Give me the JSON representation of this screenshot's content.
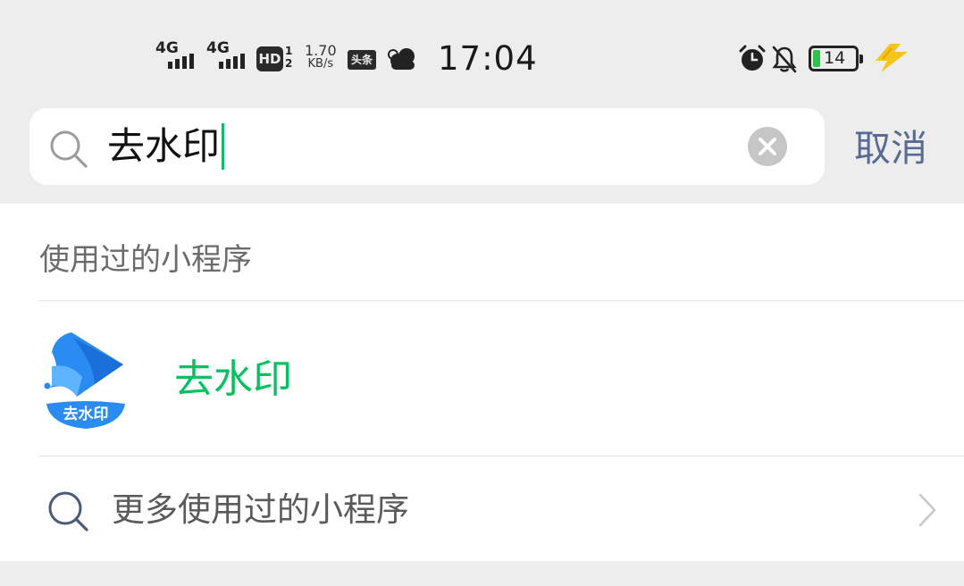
{
  "status_bar": {
    "network_1": "4G",
    "network_2": "4G",
    "hd_label": "HD",
    "hd_sub_1": "1",
    "hd_sub_2": "2",
    "speed_value": "1.70",
    "speed_unit": "KB/s",
    "news_app": "头条",
    "time": "17:04",
    "battery_level": "14",
    "battery_color": "#2ec24a",
    "icons": [
      "signal-icon",
      "cloud-icon",
      "alarm-icon",
      "bell-muted-icon",
      "battery-icon",
      "charging-bolt-icon"
    ]
  },
  "search": {
    "query": "去水印",
    "cancel_label": "取消",
    "icons": [
      "search-icon",
      "clear-icon"
    ]
  },
  "results": {
    "section_title": "使用过的小程序",
    "items": [
      {
        "name": "去水印",
        "logo_text": "去水印",
        "name_color": "#07c160"
      }
    ],
    "more_label": "更多使用过的小程序"
  },
  "colors": {
    "accent_green": "#07c160",
    "link_blue": "#576b95",
    "background": "#ededed"
  }
}
